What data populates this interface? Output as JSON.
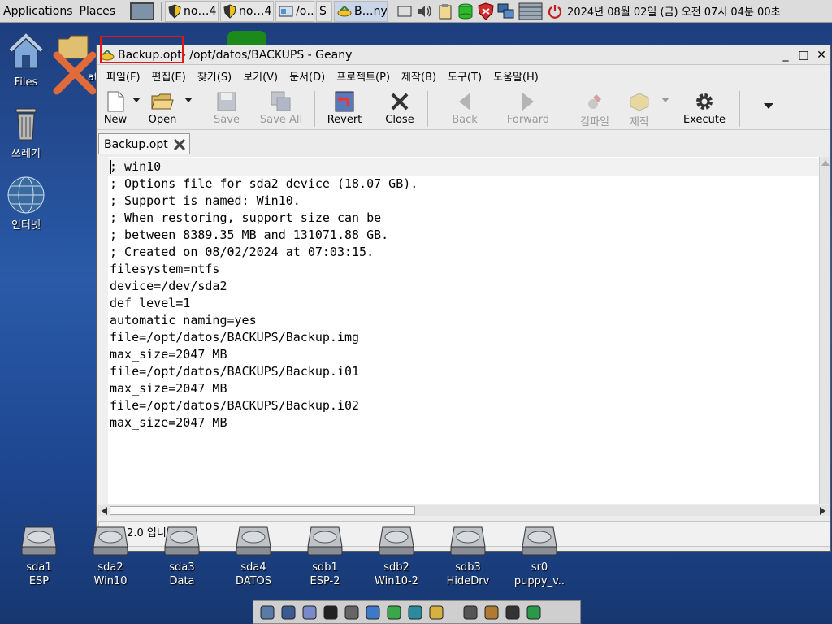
{
  "panel": {
    "menus": [
      "Applications",
      "Places"
    ],
    "tasks": [
      {
        "label": "no…4",
        "icon": "shield-app-icon"
      },
      {
        "label": "no…4",
        "icon": "shield-app-icon"
      },
      {
        "label": "/o…",
        "icon": "file-manager-icon"
      },
      {
        "label": "S",
        "icon": "app-icon"
      },
      {
        "label": "B…ny",
        "icon": "geany-icon",
        "active": true
      }
    ],
    "tray_icons": [
      "screen-icon",
      "volume-icon",
      "clipboard-icon",
      "drive-icon",
      "firewall-icon",
      "network-icon",
      "blinds-icon",
      "power-icon"
    ],
    "clock": "2024년 08월 02일 (금) 오전 07시 04분 00초"
  },
  "desktop": {
    "icons": [
      {
        "label": "Files",
        "icon": "home-icon"
      },
      {
        "label": "쓰레기",
        "icon": "trash-icon"
      },
      {
        "label": "인터넷",
        "icon": "globe-icon"
      }
    ],
    "partial_label": "ato",
    "drives": [
      {
        "name": "sda1",
        "label": "ESP"
      },
      {
        "name": "sda2",
        "label": "Win10"
      },
      {
        "name": "sda3",
        "label": "Data"
      },
      {
        "name": "sda4",
        "label": "DATOS"
      },
      {
        "name": "sdb1",
        "label": "ESP-2"
      },
      {
        "name": "sdb2",
        "label": "Win10-2"
      },
      {
        "name": "sdb3",
        "label": "HideDrv"
      },
      {
        "name": "sr0",
        "label": "puppy_v.."
      }
    ]
  },
  "window": {
    "title_file": "Backup.opt",
    "title_rest": " - /opt/datos/BACKUPS - Geany",
    "controls": [
      "_",
      "□",
      "✕"
    ],
    "menu": [
      "파일(F)",
      "편집(E)",
      "찾기(S)",
      "보기(V)",
      "문서(D)",
      "프로젝트(P)",
      "제작(B)",
      "도구(T)",
      "도움말(H)"
    ],
    "toolbar": {
      "new": "New",
      "open": "Open",
      "save": "Save",
      "save_all": "Save All",
      "revert": "Revert",
      "close": "Close",
      "back": "Back",
      "forward": "Forward",
      "compile": "컴파일",
      "build": "제작",
      "execute": "Execute"
    },
    "tab_label": "Backup.opt",
    "lines": [
      "; win10",
      "; Options file for sda2 device (18.07 GB).",
      "; Support is named: Win10.",
      "; When restoring, support size can be",
      "; between 8389.35 MB and 131071.88 GB.",
      "; Created on 08/02/2024 at 07:03:15.",
      "filesystem=ntfs",
      "device=/dev/sda2",
      "def_level=1",
      "automatic_naming=yes",
      "file=/opt/datos/BACKUPS/Backup.img",
      "max_size=2047 MB",
      "file=/opt/datos/BACKUPS/Backup.i01",
      "max_size=2047 MB",
      "file=/opt/datos/BACKUPS/Backup.i02",
      "max_size=2047 MB"
    ],
    "status": "지니 2.0 입니다."
  },
  "dock": {
    "icons": [
      "home-icon",
      "globe-icon",
      "chat-icon",
      "terminal-icon",
      "printer-icon",
      "document-icon",
      "spreadsheet-icon",
      "paint-icon",
      "edit-icon",
      "tools-icon",
      "package-icon",
      "puzzle-icon",
      "refresh-icon"
    ]
  },
  "colors": {
    "highlight": "#e31616",
    "accent": "#2a5aa8",
    "edge_line": "#c8e8c8"
  }
}
